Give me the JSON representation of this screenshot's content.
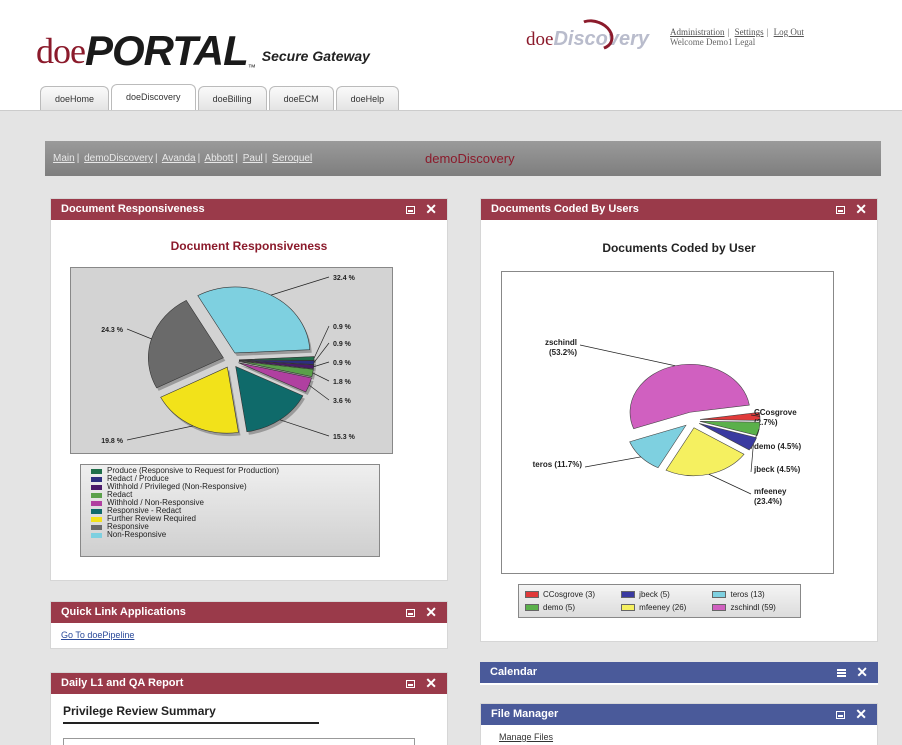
{
  "header": {
    "logo_doe": "doe",
    "logo_portal": "PORTAL",
    "logo_tm": "™",
    "logo_sub": "Secure Gateway",
    "product_doe": "doe",
    "product_b": "Discovery",
    "links": [
      "Administration",
      "Settings",
      "Log Out"
    ],
    "welcome": "Welcome Demo1 Legal"
  },
  "tabs": [
    {
      "label": "doeHome"
    },
    {
      "label": "doeDiscovery",
      "active": true
    },
    {
      "label": "doeBilling"
    },
    {
      "label": "doeECM"
    },
    {
      "label": "doeHelp"
    }
  ],
  "breadcrumb": {
    "items": [
      "Main",
      "demoDiscovery",
      "Avanda",
      "Abbott",
      "Paul",
      "Seroquel"
    ],
    "title": "demoDiscovery"
  },
  "responsiveness_panel": {
    "header": "Document Responsiveness",
    "chart_data": {
      "type": "pie",
      "title": "Document Responsiveness",
      "slices": [
        {
          "name": "Produce (Responsive to Request for Production)",
          "pct_label": "0.9 %",
          "value": 0.9,
          "color": "#1f6f4a"
        },
        {
          "name": "Redact / Produce",
          "pct_label": "0.9 %",
          "value": 0.9,
          "color": "#2e2e80"
        },
        {
          "name": "Withhold / Privileged (Non-Responsive)",
          "pct_label": "0.9 %",
          "value": 0.9,
          "color": "#4a1a6a"
        },
        {
          "name": "Redact",
          "pct_label": "1.8 %",
          "value": 1.8,
          "color": "#5aa04a"
        },
        {
          "name": "Withhold / Non-Responsive",
          "pct_label": "3.6 %",
          "value": 3.6,
          "color": "#b040a0"
        },
        {
          "name": "Responsive - Redact",
          "pct_label": "15.3 %",
          "value": 15.3,
          "color": "#0f6a6a"
        },
        {
          "name": "Further Review Required",
          "pct_label": "19.8 %",
          "value": 19.8,
          "color": "#f2e21a"
        },
        {
          "name": "Responsive",
          "pct_label": "24.3 %",
          "value": 24.3,
          "color": "#6a6a6a"
        },
        {
          "name": "Non-Responsive",
          "pct_label": "32.4 %",
          "value": 32.4,
          "color": "#7ed0e0"
        }
      ]
    }
  },
  "coded_panel": {
    "header": "Documents Coded By Users",
    "chart_data": {
      "type": "pie",
      "title": "Documents Coded by User",
      "slices": [
        {
          "name": "CCosgrove",
          "count": 3,
          "pct_label": "(2.7%)",
          "value": 2.7,
          "color": "#e03a3a"
        },
        {
          "name": "demo",
          "count": 5,
          "pct_label": "(4.5%)",
          "value": 4.5,
          "color": "#5ab04a"
        },
        {
          "name": "jbeck",
          "count": 5,
          "pct_label": "(4.5%)",
          "value": 4.5,
          "color": "#3a3aa0"
        },
        {
          "name": "mfeeney",
          "count": 26,
          "pct_label": "(23.4%)",
          "value": 23.4,
          "color": "#f5f060"
        },
        {
          "name": "teros",
          "count": 13,
          "pct_label": "(11.7%)",
          "value": 11.7,
          "color": "#7ed0e0"
        },
        {
          "name": "zschindl",
          "count": 59,
          "pct_label": "(53.2%)",
          "value": 53.2,
          "color": "#d060c0"
        }
      ],
      "callouts": {
        "zschindl": [
          "zschindl",
          "(53.2%)"
        ],
        "CCosgrove": [
          "CCosgrove",
          "(2.7%)"
        ],
        "demo": [
          "demo (4.5%)"
        ],
        "jbeck": [
          "jbeck (4.5%)"
        ],
        "mfeeney": [
          "mfeeney",
          "(23.4%)"
        ],
        "teros": [
          "teros (11.7%)"
        ]
      },
      "legend": [
        "CCosgrove (3)",
        "jbeck (5)",
        "teros (13)",
        "demo (5)",
        "mfeeney (26)",
        "zschindl (59)"
      ]
    }
  },
  "quick_links": {
    "header": "Quick Link Applications",
    "link": "Go To doePipeline"
  },
  "daily_report": {
    "header": "Daily L1 and QA Report",
    "subheading": "Privilege Review Summary"
  },
  "calendar": {
    "header": "Calendar"
  },
  "file_manager": {
    "header": "File Manager",
    "link": "Manage Files"
  }
}
